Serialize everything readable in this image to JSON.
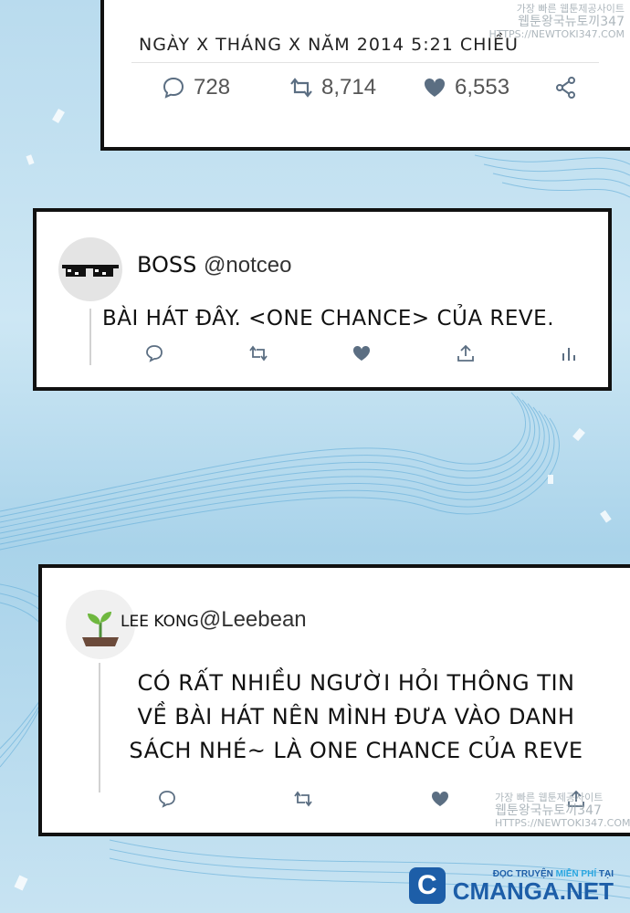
{
  "tweet_top": {
    "date": "NGÀY X THÁNG X NĂM 2014 5:21 CHIỀU",
    "replies": "728",
    "retweets": "8,714",
    "likes": "6,553"
  },
  "tweet_boss": {
    "name": "BOSS",
    "handle": "@notceo",
    "text": "BÀI HÁT ĐÂY. <ONE CHANCE> CỦA REVE."
  },
  "tweet_leekong": {
    "name": "LEE KONG",
    "handle": "@Leebean",
    "lines": [
      "CÓ RẤT NHIỀU NGƯỜI HỎI THÔNG TIN",
      "VỀ BÀI HÁT NÊN MÌNH ĐƯA VÀO DANH",
      "SÁCH NHÉ~ LÀ ONE CHANCE CỦA REVE"
    ]
  },
  "watermarks": {
    "top_line1": "가장 빠른 웹툰제공사이트",
    "top_line2": "웹툰왕국뉴토끼347",
    "top_line3": "HTTPS://NEWTOKI347.COM",
    "bottom_line1": "가장 빠른 웹툰제공사이트",
    "bottom_line2": "웹툰왕국뉴토끼347",
    "bottom_line3": "HTTPS://NEWTOKI347.COM"
  },
  "brand": {
    "tagline_pre": "ĐỌC TRUYỆN ",
    "tagline_highlight": "MIỄN PHÍ",
    "tagline_post": " TẠI",
    "name": "CMANGA.NET"
  },
  "colors": {
    "accent": "#1d5ea8",
    "background": "#b9dbee",
    "icon": "#5b6e82"
  }
}
